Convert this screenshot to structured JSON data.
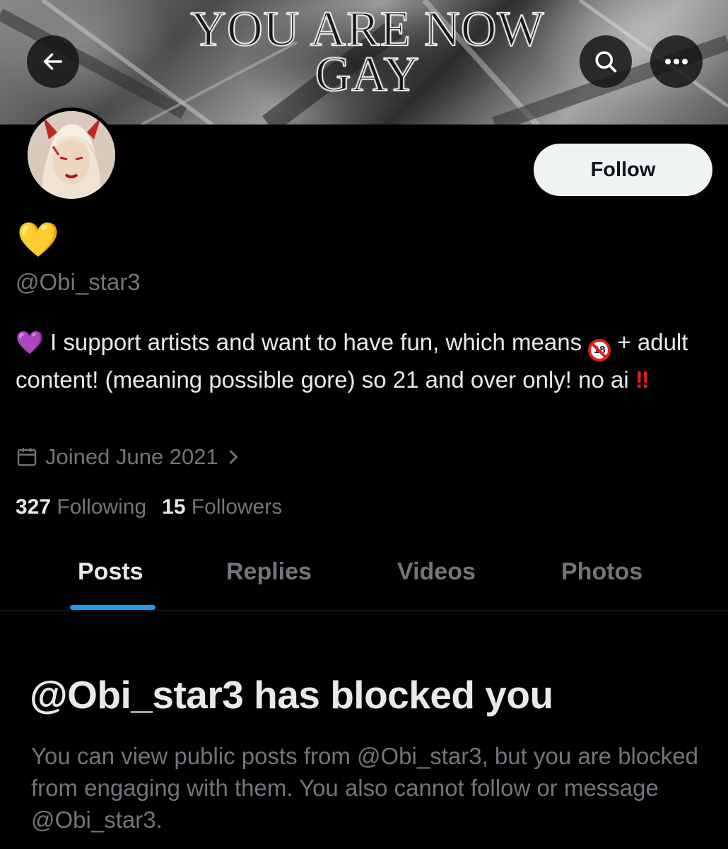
{
  "banner": {
    "title": "YOU ARE NOW GAY"
  },
  "header": {
    "back_icon": "arrow-left-icon",
    "search_icon": "search-icon",
    "more_icon": "more-horizontal-icon"
  },
  "profile": {
    "display_name": "💛",
    "handle": "@Obi_star3",
    "follow_label": "Follow",
    "bio": {
      "lead_emoji": "💜",
      "text_1": " I support artists and want to have fun, which means ",
      "badge": "18",
      "text_2": " + adult content! (meaning possible gore) so 21 and over only! no ai ",
      "trail": "‼"
    },
    "joined": "Joined June 2021",
    "following_count": "327",
    "following_label": "Following",
    "followers_count": "15",
    "followers_label": "Followers"
  },
  "tabs": [
    {
      "label": "Posts",
      "active": true
    },
    {
      "label": "Replies",
      "active": false
    },
    {
      "label": "Videos",
      "active": false
    },
    {
      "label": "Photos",
      "active": false
    }
  ],
  "blocked": {
    "title": "@Obi_star3 has blocked you",
    "message": "You can view public posts from @Obi_star3, but you are blocked from engaging with them. You also cannot follow or message @Obi_star3."
  },
  "colors": {
    "accent": "#1d9bf0",
    "background": "#000000",
    "muted_text": "#71767b",
    "primary_text": "#e7e9ea"
  }
}
